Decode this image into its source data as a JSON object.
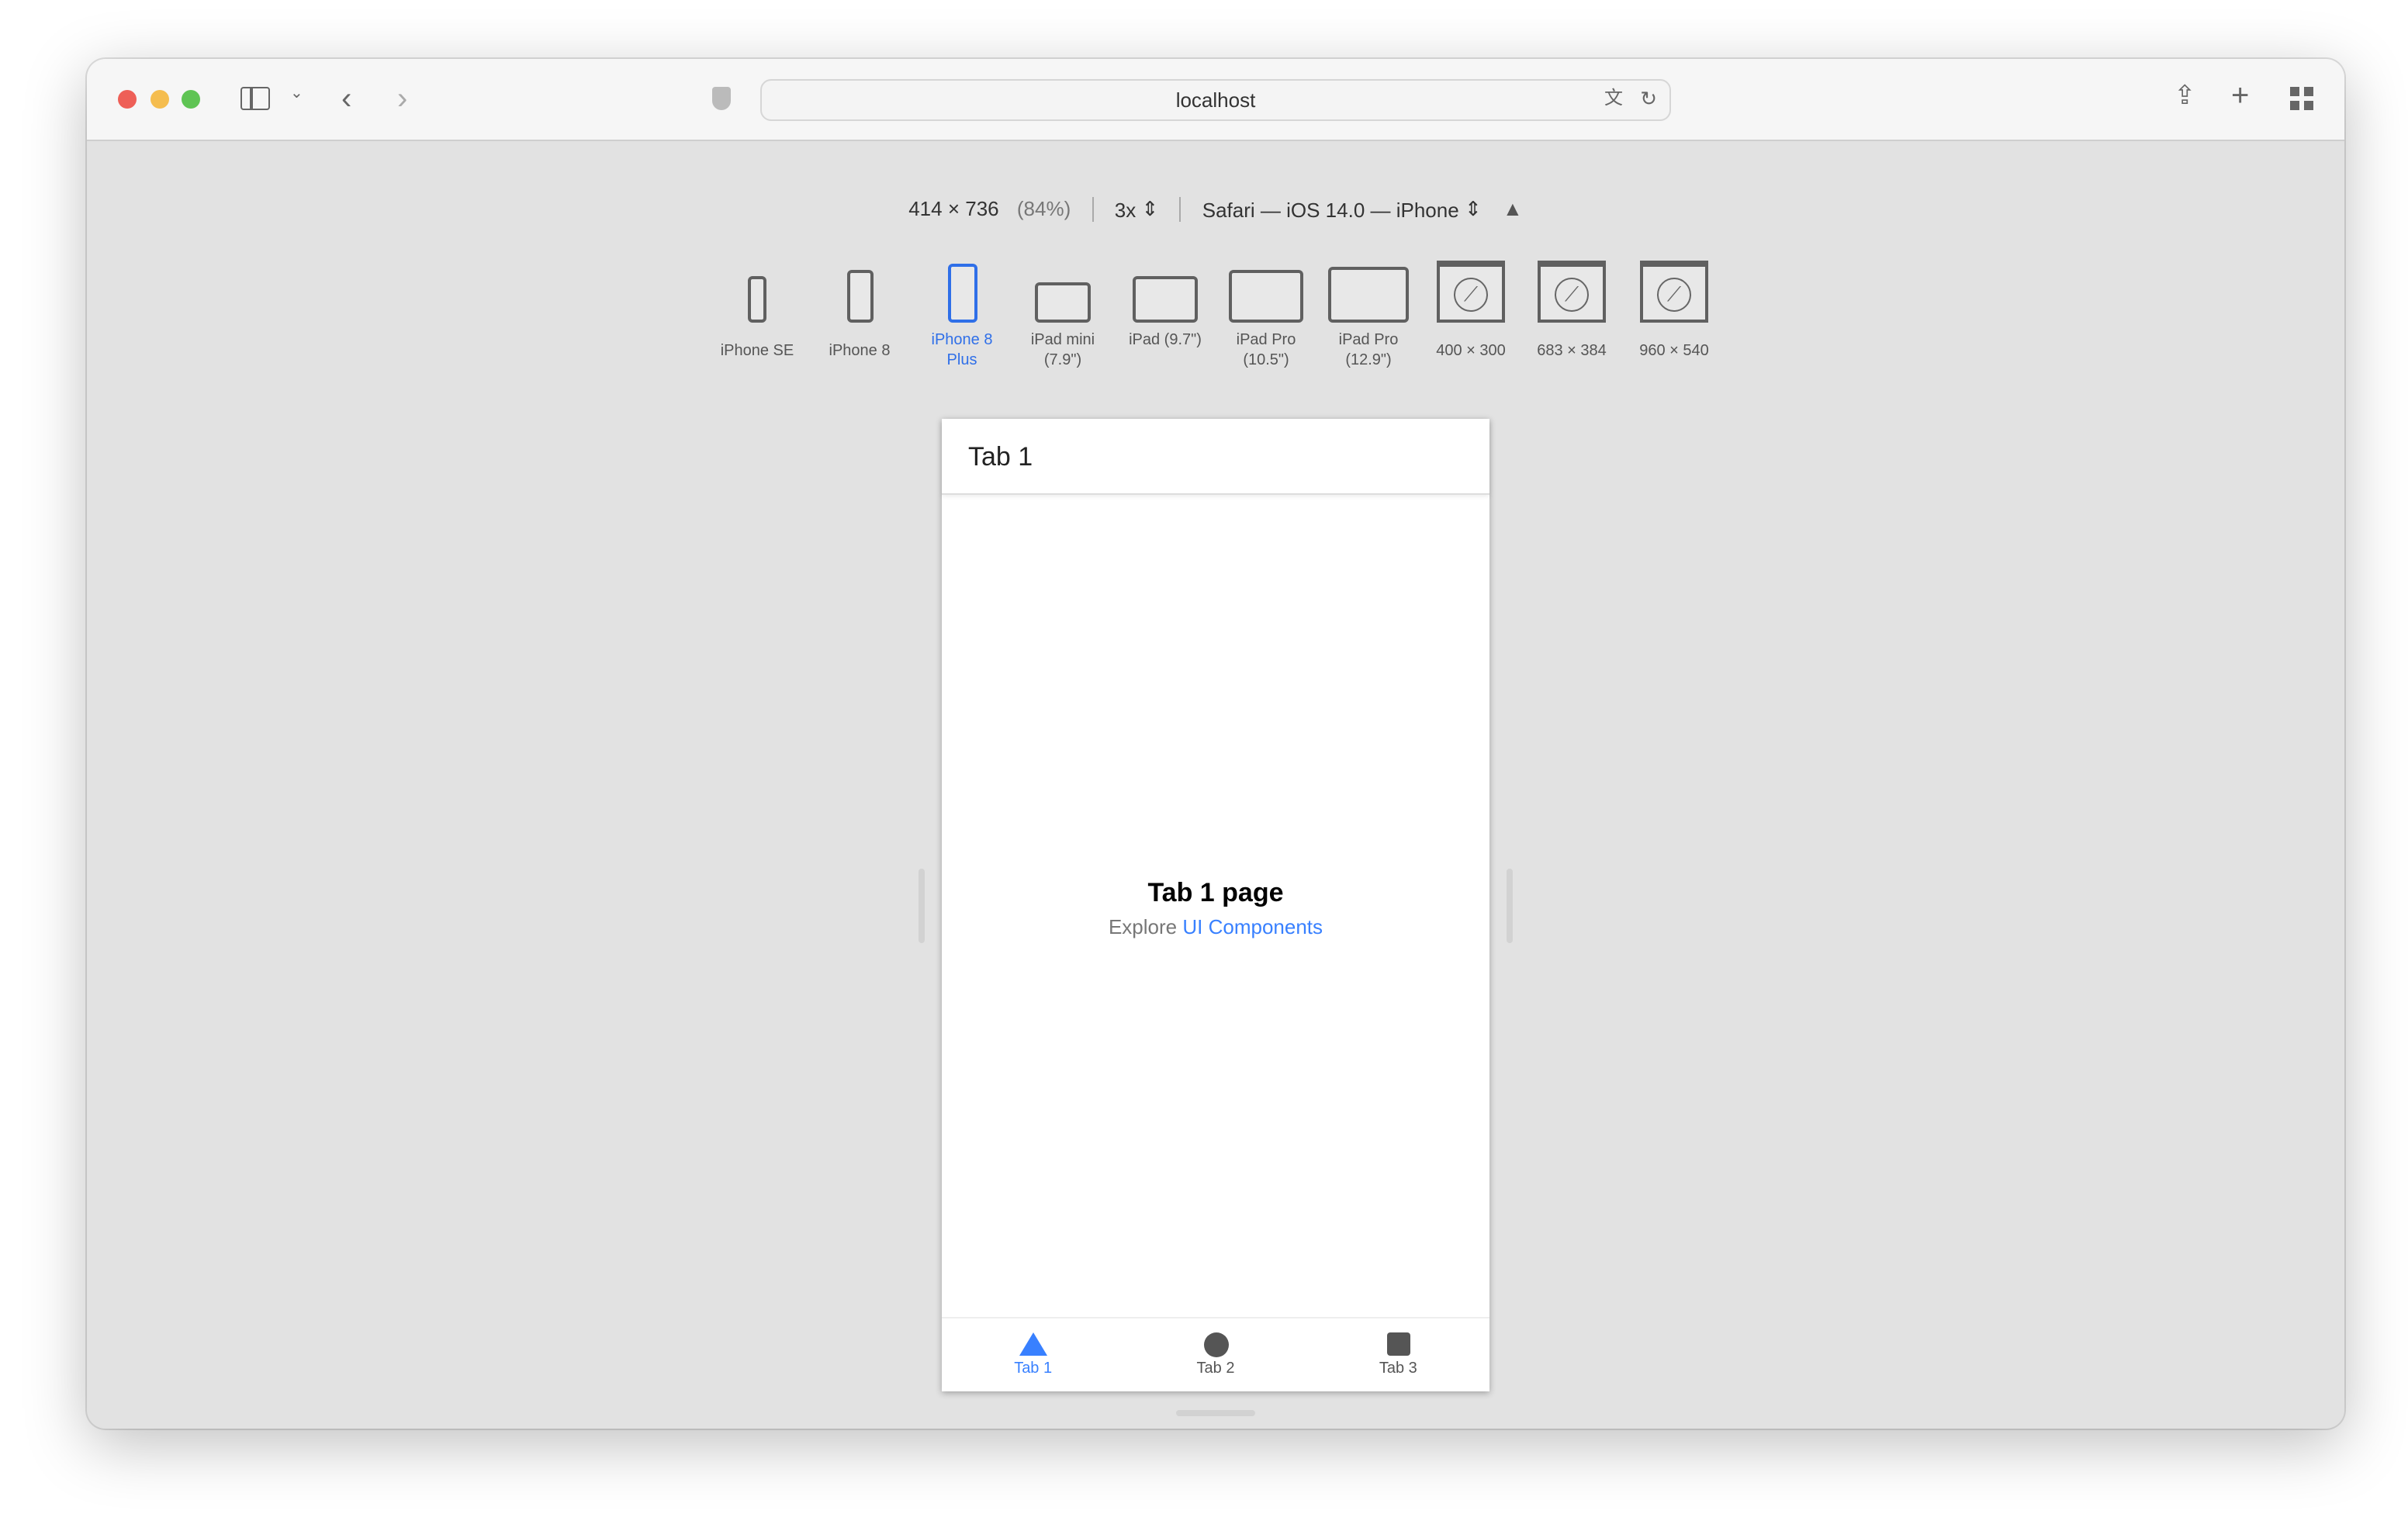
{
  "browser": {
    "url": "localhost",
    "colors": {
      "close": "#ee5f57",
      "minimize": "#f5bd4f",
      "zoom": "#5fc454"
    }
  },
  "responsive": {
    "dimensions": "414 × 736",
    "percent": "(84%)",
    "scale": "3x",
    "user_agent": "Safari — iOS 14.0 — iPhone",
    "devices": [
      {
        "label": "iPhone SE"
      },
      {
        "label": "iPhone 8"
      },
      {
        "label": "iPhone 8 Plus",
        "selected": true
      },
      {
        "label": "iPad mini (7.9\")"
      },
      {
        "label": "iPad (9.7\")"
      },
      {
        "label": "iPad Pro (10.5\")"
      },
      {
        "label": "iPad Pro (12.9\")"
      },
      {
        "label": "400 × 300"
      },
      {
        "label": "683 × 384"
      },
      {
        "label": "960 × 540"
      }
    ],
    "accent": "#2f6fe8"
  },
  "app": {
    "header_title": "Tab 1",
    "page_title": "Tab 1 page",
    "explore_text": "Explore",
    "explore_link": "UI Components",
    "tabs": [
      {
        "label": "Tab 1",
        "icon": "triangle-icon",
        "active": true
      },
      {
        "label": "Tab 2",
        "icon": "circle-icon"
      },
      {
        "label": "Tab 3",
        "icon": "square-icon"
      }
    ],
    "accent": "#3880ff"
  }
}
